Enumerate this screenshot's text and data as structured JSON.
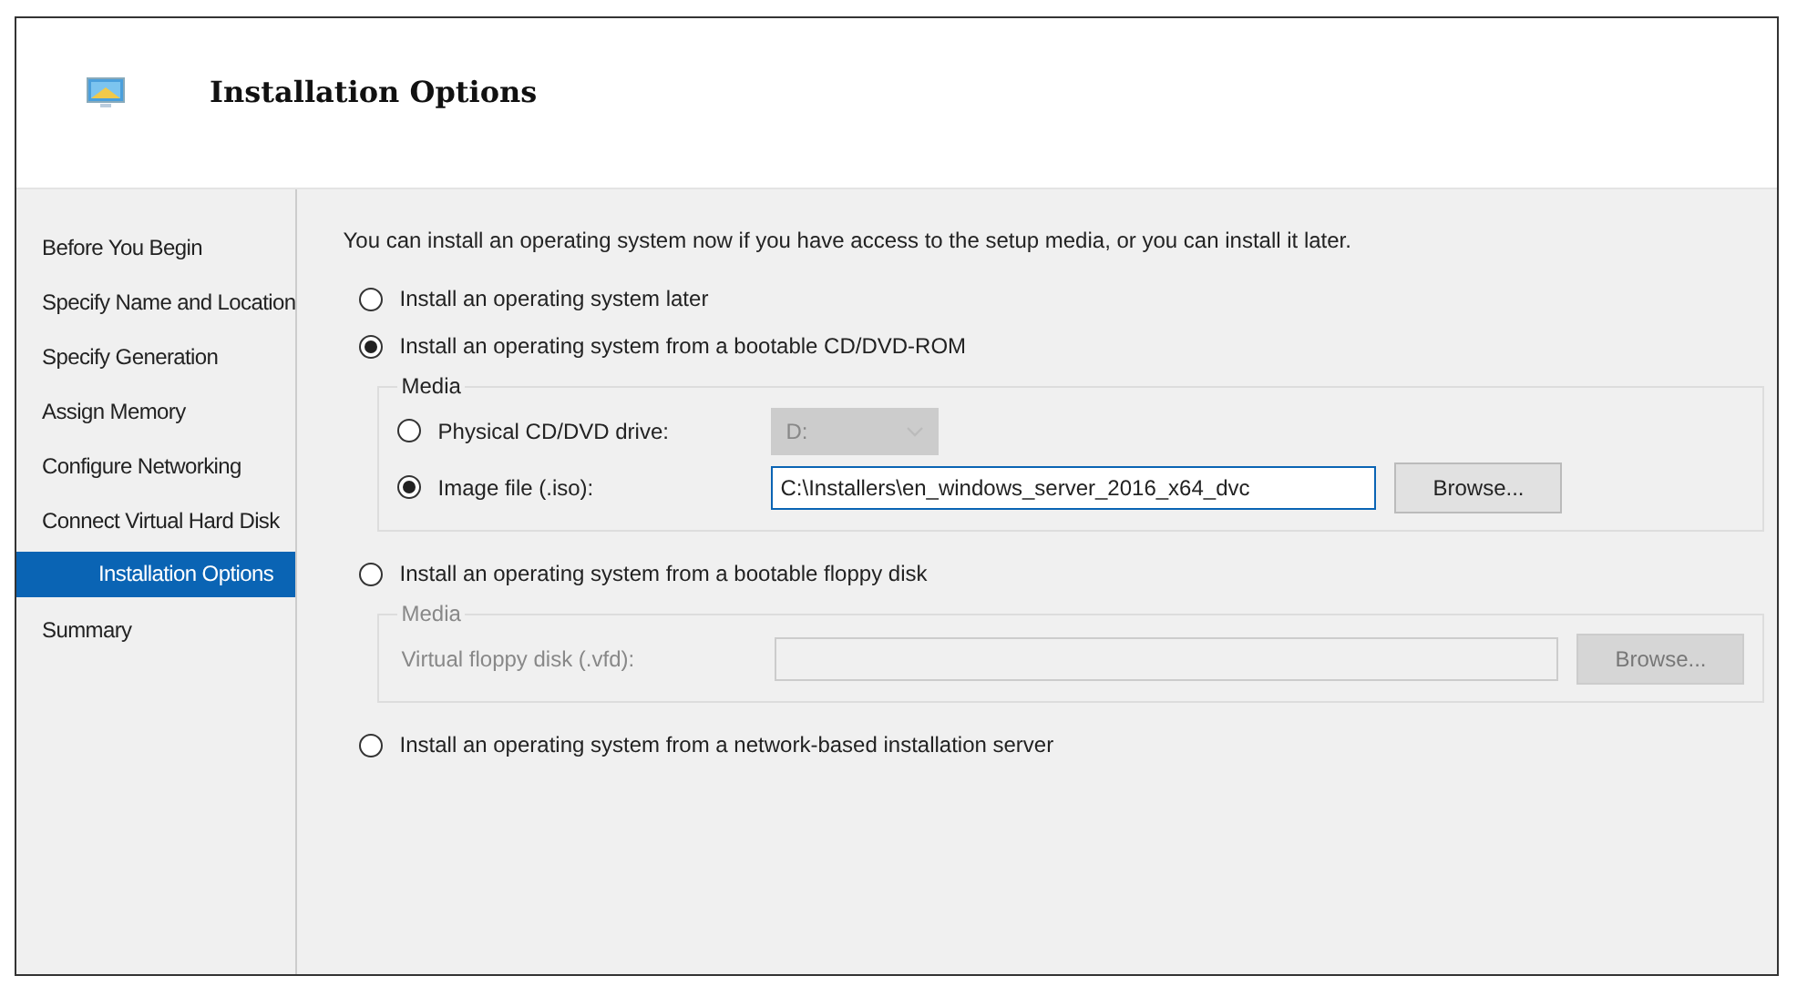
{
  "header": {
    "title": "Installation Options"
  },
  "sidebar": {
    "items": [
      {
        "label": "Before You Begin",
        "selected": false,
        "indented": false
      },
      {
        "label": "Specify Name and Location",
        "selected": false,
        "indented": false
      },
      {
        "label": "Specify Generation",
        "selected": false,
        "indented": false
      },
      {
        "label": "Assign Memory",
        "selected": false,
        "indented": false
      },
      {
        "label": "Configure Networking",
        "selected": false,
        "indented": false
      },
      {
        "label": "Connect Virtual Hard Disk",
        "selected": false,
        "indented": false
      },
      {
        "label": "Installation Options",
        "selected": true,
        "indented": true
      },
      {
        "label": "Summary",
        "selected": false,
        "indented": false
      }
    ]
  },
  "intro": "You can install an operating system now if you have access to the setup media, or you can install it later.",
  "options": [
    {
      "label": "Install an operating system later",
      "selected": false
    },
    {
      "label": "Install an operating system from a bootable CD/DVD-ROM",
      "selected": true,
      "media": {
        "title": "Media",
        "disabled": false,
        "rows": [
          {
            "kind": "radio",
            "label": "Physical CD/DVD drive:",
            "selected": false,
            "control": {
              "kind": "dropdown",
              "value": "D:",
              "disabled": true
            }
          },
          {
            "kind": "radio",
            "label": "Image file (.iso):",
            "selected": true,
            "control": {
              "kind": "path",
              "value": "C:\\Installers\\en_windows_server_2016_x64_dvc",
              "disabled": false
            },
            "button": "Browse..."
          }
        ]
      }
    },
    {
      "label": "Install an operating system from a bootable floppy disk",
      "selected": false,
      "media": {
        "title": "Media",
        "disabled": true,
        "rows": [
          {
            "kind": "label",
            "label": "Virtual floppy disk (.vfd):",
            "control": {
              "kind": "path",
              "disabled": true
            },
            "button": "Browse..."
          }
        ]
      }
    },
    {
      "label": "Install an operating system from a network-based installation server",
      "selected": false
    }
  ]
}
